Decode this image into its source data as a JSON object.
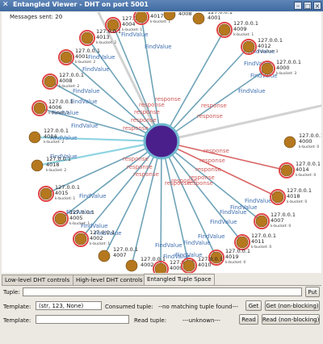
{
  "window": {
    "title": "Entangled Viewer - DHT on port 5001",
    "minimize_glyph": "–",
    "maximize_glyph": "□",
    "close_glyph": "×",
    "system_icon_glyph": "✕"
  },
  "viewer": {
    "messages_sent": "Messages sent: 20",
    "center_node_color": "#4a1f8c",
    "peer_node_color": "#b5781f",
    "highlight_ring_color": "#e04646",
    "findvalue_label": "FindValue",
    "response_label": "response",
    "nodes": [
      {
        "ip": "127.0.0.1",
        "port": "4004",
        "bucket": "k-bucket: 1"
      },
      {
        "ip": "127.0.0.1",
        "port": "4017",
        "bucket": "k-bucket: 1"
      },
      {
        "ip": "127.0.0.1",
        "port": "4008",
        "bucket": ""
      },
      {
        "ip": "127.0.0.1",
        "port": "4001",
        "bucket": ""
      },
      {
        "ip": "127.0.0.1",
        "port": "4009",
        "bucket": "k-bucket: 1"
      },
      {
        "ip": "127.0.0.1",
        "port": "4013",
        "bucket": "k-bucket: 2"
      },
      {
        "ip": "127.0.0.1",
        "port": "4001",
        "bucket": "k-bucket: 2"
      },
      {
        "ip": "127.0.0.1",
        "port": "4012",
        "bucket": "k-bucket: 3"
      },
      {
        "ip": "127.0.0.1",
        "port": "4000",
        "bucket": "k-bucket: 3"
      },
      {
        "ip": "127.0.0.1",
        "port": "4008",
        "bucket": "k-bucket: 2"
      },
      {
        "ip": "127.0.0.1",
        "port": "4006",
        "bucket": "k-bucket: 2"
      },
      {
        "ip": "127.0.0.1",
        "port": "4014",
        "bucket": "k-bucket: 2"
      },
      {
        "ip": "127.0.0.1",
        "port": "4000",
        "bucket": "k-bucket: 0"
      },
      {
        "ip": "127.0.0.1",
        "port": "4018",
        "bucket": "k-bucket: 2"
      },
      {
        "ip": "127.0.0.1",
        "port": "4014",
        "bucket": "k-bucket: 0"
      },
      {
        "ip": "127.0.0.1",
        "port": "4015",
        "bucket": "k-bucket: 1"
      },
      {
        "ip": "127.0.0.1",
        "port": "4018",
        "bucket": "k-bucket: 0"
      },
      {
        "ip": "127.0.0.1",
        "port": "4005",
        "bucket": "k-bucket: 1"
      },
      {
        "ip": "127.0.0.1",
        "port": "4007",
        "bucket": "k-bucket: 0"
      },
      {
        "ip": "127.0.0.1",
        "port": "4002",
        "bucket": "k-bucket: 1"
      },
      {
        "ip": "127.0.0.1",
        "port": "4011",
        "bucket": "k-bucket: 0"
      },
      {
        "ip": "127.0.0.1",
        "port": "4007",
        "bucket": ""
      },
      {
        "ip": "127.0.0.1",
        "port": "4019",
        "bucket": "k-bucket: 0"
      },
      {
        "ip": "127.0.0.1",
        "port": "4002",
        "bucket": ""
      },
      {
        "ip": "127.0.0.1",
        "port": "4009",
        "bucket": ""
      },
      {
        "ip": "127.0.0.1",
        "port": "4010",
        "bucket": ""
      }
    ]
  },
  "tabs": [
    {
      "label": "Low-level DHT controls"
    },
    {
      "label": "High-level DHT controls"
    },
    {
      "label": "Entangled Tuple Space"
    }
  ],
  "tuple_space": {
    "tuple_label": "Tuple:",
    "tuple_value": "",
    "put_label": "Put",
    "template1_label": "Template:",
    "template1_value": "(str, 123, None)",
    "consumed_label": "Consumed tuple:",
    "consumed_value": "--no matching tuple found---",
    "get_label": "Get",
    "get_nb_label": "Get (non-blocking)",
    "template2_label": "Template:",
    "template2_value": "",
    "read_tuple_label": "Read tuple:",
    "read_tuple_value": "---unknown---",
    "read_label": "Read",
    "read_nb_label": "Read (non-blocking)"
  }
}
